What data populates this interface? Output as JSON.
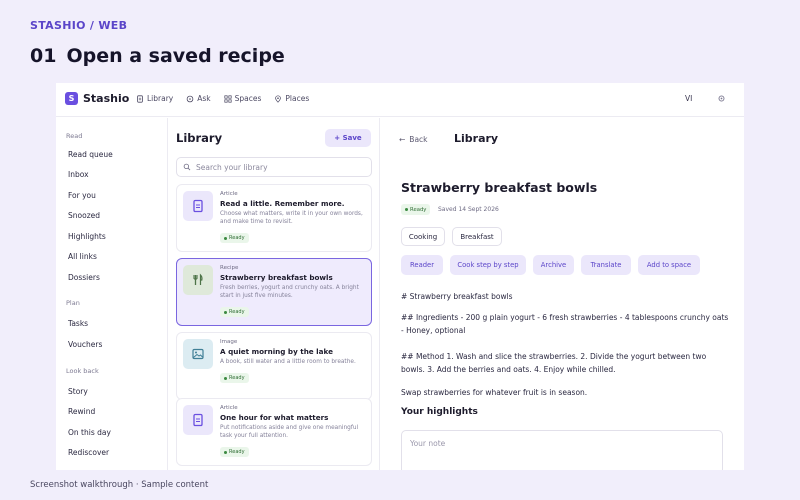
{
  "crumb": "STASHIO / WEB",
  "headline": {
    "number": "01",
    "title": "Open a saved recipe"
  },
  "footer": "Screenshot walkthrough · Sample content",
  "app": {
    "logo": "Stashio",
    "logo_mark": "S",
    "nav": [
      {
        "label": "Library",
        "icon": "document-icon"
      },
      {
        "label": "Ask",
        "icon": "chat-icon"
      },
      {
        "label": "Spaces",
        "icon": "grid-icon"
      },
      {
        "label": "Places",
        "icon": "pin-icon"
      }
    ],
    "user_initials": "VI",
    "sidebar": {
      "sections": [
        {
          "label": "Read",
          "items": [
            "Read queue",
            "Inbox",
            "For you",
            "Snoozed",
            "Highlights",
            "All links",
            "Dossiers"
          ]
        },
        {
          "label": "Plan",
          "items": [
            "Tasks",
            "Vouchers"
          ]
        },
        {
          "label": "Look back",
          "items": [
            "Story",
            "Rewind",
            "On this day",
            "Rediscover"
          ]
        }
      ]
    },
    "library": {
      "title": "Library",
      "save_label": "+ Save",
      "search_placeholder": "Search your library",
      "cards": [
        {
          "kind": "Article",
          "title": "Read a little. Remember more.",
          "desc": "Choose what matters, write it in your own words, and make time to revisit.",
          "badge": "Ready",
          "icon": "document-icon"
        },
        {
          "kind": "Recipe",
          "title": "Strawberry breakfast bowls",
          "desc": "Fresh berries, yogurt and crunchy oats. A bright start in just five minutes.",
          "badge": "Ready",
          "icon": "fork-knife-icon"
        },
        {
          "kind": "Image",
          "title": "A quiet morning by the lake",
          "desc": "A book, still water and a little room to breathe.",
          "badge": "Ready",
          "icon": "image-icon"
        },
        {
          "kind": "Article",
          "title": "One hour for what matters",
          "desc": "Put notifications aside and give one meaningful task your full attention.",
          "badge": "Ready",
          "icon": "document-icon"
        }
      ]
    },
    "detail": {
      "back_label": "Back",
      "header_title": "Library",
      "title": "Strawberry breakfast bowls",
      "status": "Ready",
      "saved": "Saved 14 Sept 2026",
      "tags": [
        "Cooking",
        "Breakfast"
      ],
      "actions": [
        "Reader",
        "Cook step by step",
        "Archive",
        "Translate",
        "Add to space"
      ],
      "paragraphs": [
        "# Strawberry breakfast bowls",
        "## Ingredients - 200 g plain yogurt - 6 fresh strawberries - 4 tablespoons crunchy oats - Honey, optional",
        "## Method 1. Wash and slice the strawberries. 2. Divide the yogurt between two bowls. 3. Add the berries and oats. 4. Enjoy while chilled.",
        "Swap strawberries for whatever fruit is in season."
      ],
      "highlights_title": "Your highlights",
      "note_placeholder": "Your note"
    }
  }
}
